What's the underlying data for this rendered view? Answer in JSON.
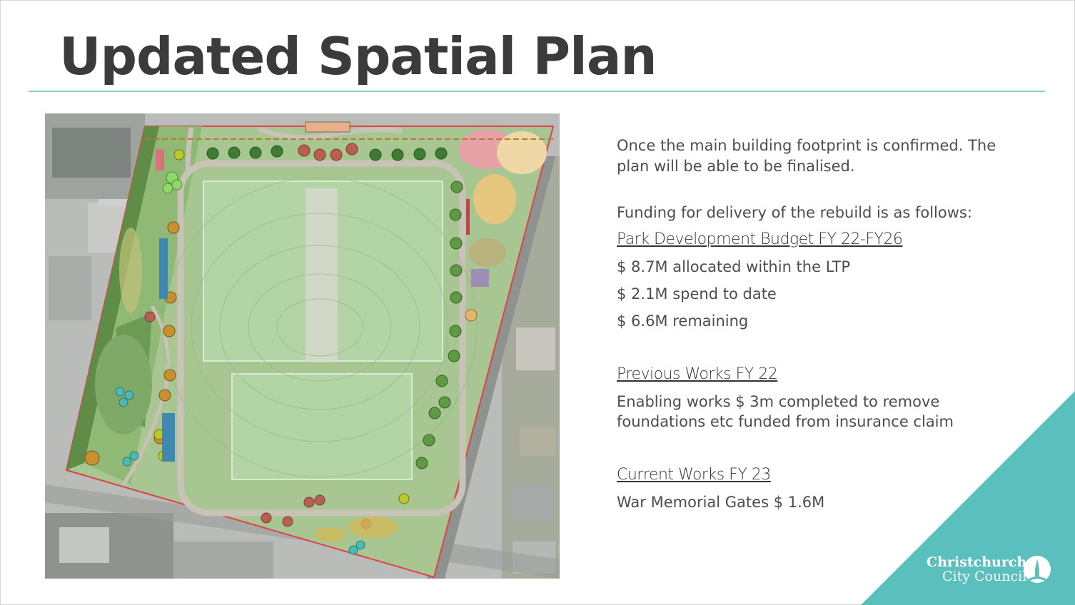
{
  "slide": {
    "title": "Updated Spatial Plan",
    "intro": [
      "Once the main building footprint is confirmed. The",
      "plan will be able to be finalised."
    ],
    "funding_intro": "Funding for delivery of the rebuild is as follows:",
    "budget": {
      "heading": "Park Development Budget FY 22-FY26",
      "items": [
        "$ 8.7M allocated within the LTP",
        "$ 2.1M spend to date",
        "$ 6.6M remaining"
      ]
    },
    "previous": {
      "heading": "Previous Works FY 22",
      "lines": [
        "Enabling works $ 3m completed to remove",
        "foundations etc funded from insurance claim"
      ]
    },
    "current": {
      "heading": "Current Works FY 23",
      "lines": [
        "War Memorial Gates $ 1.6M"
      ]
    },
    "logo": {
      "line1": "Christchurch",
      "line2": "City Council"
    },
    "colors": {
      "accent": "#5bbfbd",
      "rule": "#7fcfcf",
      "title": "#3b3b3b",
      "boundary": "#e0414a"
    }
  }
}
